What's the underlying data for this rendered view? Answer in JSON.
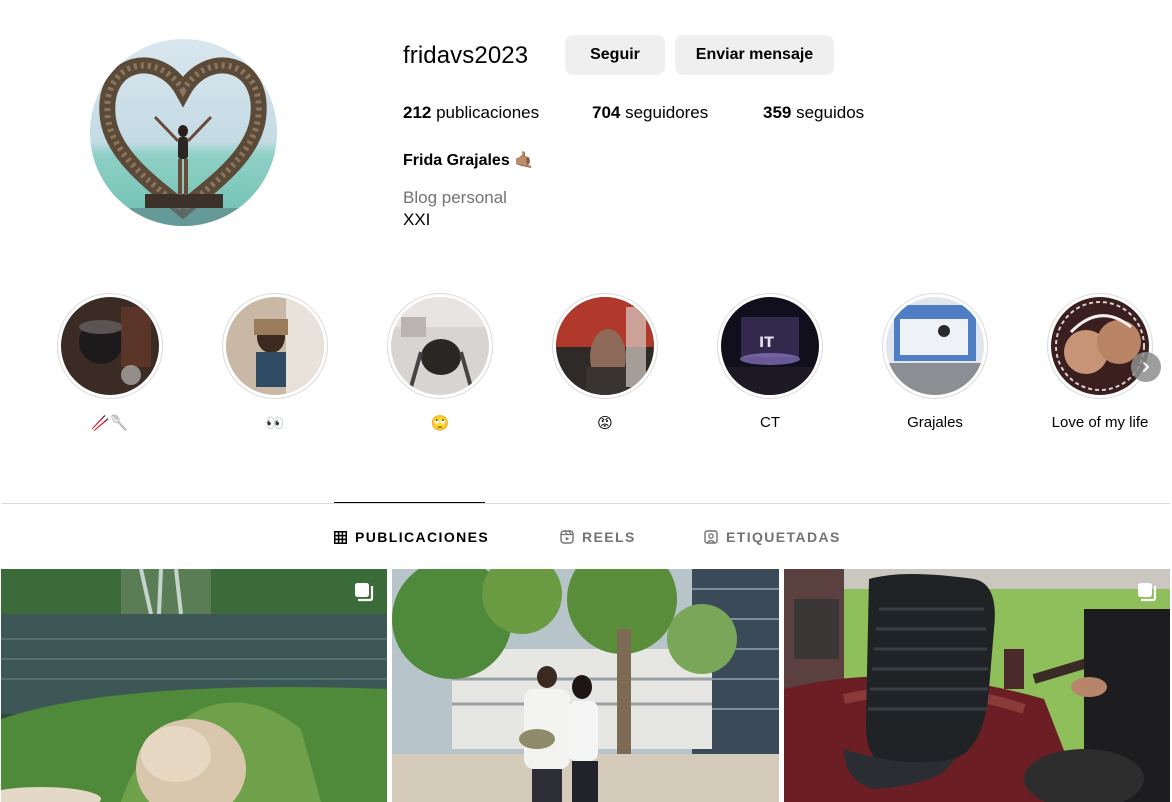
{
  "profile": {
    "username": "fridavs2023",
    "follow_label": "Seguir",
    "message_label": "Enviar mensaje",
    "posts_count": "212",
    "posts_word": " publicaciones",
    "followers_count": "704",
    "followers_word": " seguidores",
    "following_count": "359",
    "following_word": " seguidos",
    "full_name": "Frida Grajales",
    "full_name_emoji": "🤙🏽",
    "category": "Blog personal",
    "bio": "XXI"
  },
  "highlights": [
    {
      "label": "🥢🥄"
    },
    {
      "label": "👀"
    },
    {
      "label": "🙄"
    },
    {
      "label": "😡"
    },
    {
      "label": "CT"
    },
    {
      "label": "Grajales"
    },
    {
      "label": "Love of my life"
    }
  ],
  "tabs": [
    {
      "label": "PUBLICACIONES",
      "icon": "grid-icon",
      "active": true
    },
    {
      "label": "REELS",
      "icon": "reels-icon",
      "active": false
    },
    {
      "label": "ETIQUETADAS",
      "icon": "tagged-icon",
      "active": false
    }
  ],
  "posts": [
    {
      "icon": "carousel-icon",
      "multi": true
    },
    {
      "multi": false
    },
    {
      "icon": "carousel-icon",
      "multi": true
    }
  ],
  "colors": {
    "button_bg": "#efefef",
    "secondary_text": "#737373",
    "divider": "#dbdbdb"
  }
}
